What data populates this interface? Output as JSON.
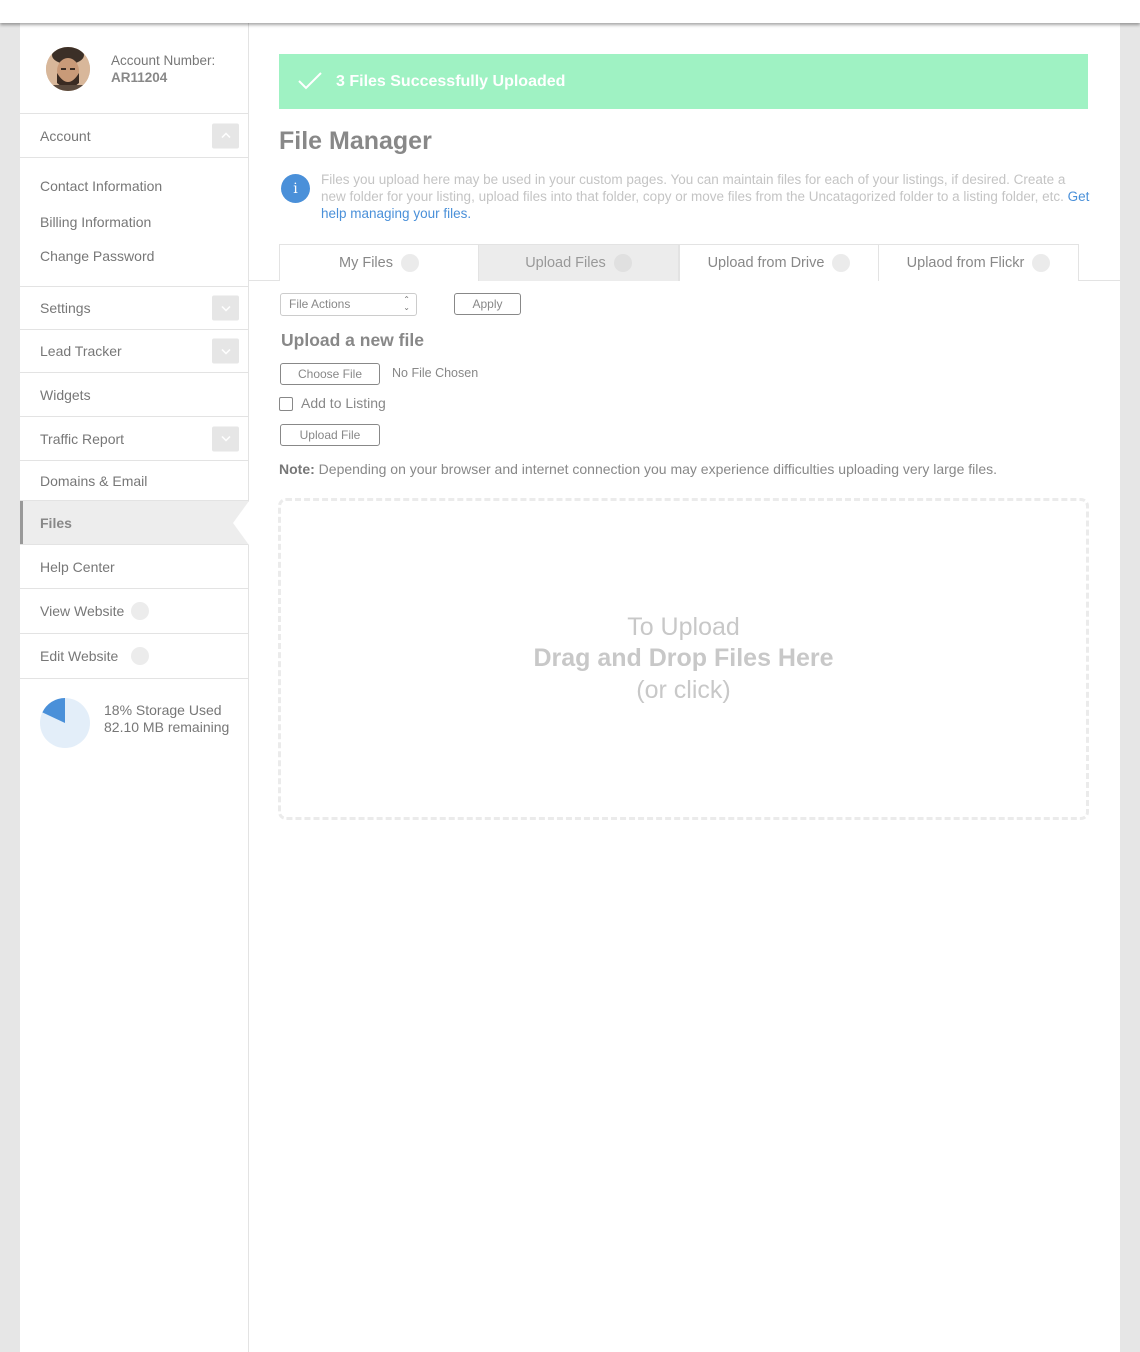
{
  "account": {
    "label": "Account Number:",
    "number": "AR11204"
  },
  "sidebar": {
    "account_section": "Account",
    "account_subitems": [
      "Contact Information",
      "Billing Information",
      "Change Password"
    ],
    "items": [
      "Settings",
      "Lead Tracker",
      "Widgets",
      "Traffic Report",
      "Domains & Email",
      "Files",
      "Help Center",
      "View Website",
      "Edit Website"
    ],
    "active": "Files"
  },
  "storage": {
    "used_percent": 18,
    "used_label": "18% Storage Used",
    "remaining_label": "82.10 MB remaining",
    "color_used": "#4a90d9",
    "color_free": "#e3eef9"
  },
  "alert": {
    "text": "3 Files Successfully Uploaded",
    "color": "#9ff2c3"
  },
  "page": {
    "title": "File Manager",
    "info_text": "Files you upload here may be used in your custom pages. You can maintain files for each of your listings, if desired. Create a new folder for your listing, upload files into that folder, copy or move files from the Uncatagorized folder to a listing folder, etc.",
    "info_link": "Get help managing your files."
  },
  "tabs": [
    "My Files",
    "Upload Files",
    "Upload from Drive",
    "Uplaod from Flickr"
  ],
  "selected_tab": "Upload Files",
  "toolbar": {
    "file_actions": "File Actions",
    "apply": "Apply"
  },
  "upload": {
    "title": "Upload a new file",
    "choose_file": "Choose File",
    "no_file": "No File Chosen",
    "add_to_listing": "Add to Listing",
    "upload_button": "Upload File",
    "note_label": "Note:",
    "note_text": "Depending on your browser and internet connection you may experience difficulties uploading very large files."
  },
  "dropzone": {
    "line1": "To Upload",
    "line2": "Drag and Drop Files Here",
    "line3": "(or click)"
  }
}
